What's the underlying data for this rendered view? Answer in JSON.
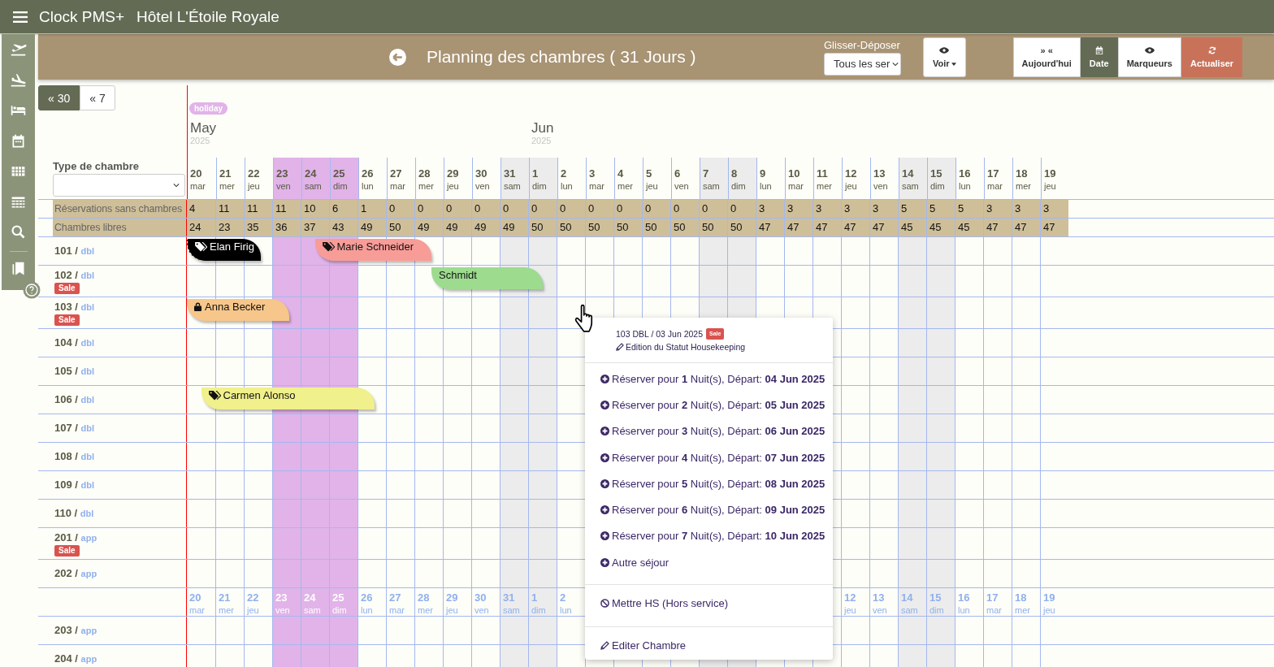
{
  "app": {
    "name": "Clock PMS+",
    "hotel": "Hôtel L'Étoile Royale"
  },
  "toolbar": {
    "title": "Planning des chambres ( 31 Jours )",
    "drag_label": "Glisser-Déposer",
    "filter_value": "Tous les ser",
    "buttons": [
      {
        "kind": "eye",
        "label": "Voir",
        "selected": false
      },
      {
        "kind": "glyph",
        "glyph": "» «",
        "label": "Aujourd'hui",
        "selected": false
      },
      {
        "kind": "calendar",
        "label": "Date",
        "selected": true
      },
      {
        "kind": "eye",
        "label": "Marqueurs",
        "selected": false
      },
      {
        "kind": "refresh",
        "label": "Actualiser",
        "selected": false
      }
    ]
  },
  "range_buttons": [
    {
      "label": "« 30",
      "selected": true
    },
    {
      "label": "« 7",
      "selected": false
    }
  ],
  "holiday_badge": "holiday",
  "months": [
    {
      "name": "May",
      "year": "2025"
    },
    {
      "name": "Jun",
      "year": "2025"
    }
  ],
  "room_type_label": "Type de chambre",
  "days": [
    {
      "num": "20",
      "dow": "mar",
      "kind": "weekday"
    },
    {
      "num": "21",
      "dow": "mer",
      "kind": "weekday"
    },
    {
      "num": "22",
      "dow": "jeu",
      "kind": "weekday"
    },
    {
      "num": "23",
      "dow": "ven",
      "kind": "holiday"
    },
    {
      "num": "24",
      "dow": "sam",
      "kind": "holiday"
    },
    {
      "num": "25",
      "dow": "dim",
      "kind": "holiday"
    },
    {
      "num": "26",
      "dow": "lun",
      "kind": "weekday"
    },
    {
      "num": "27",
      "dow": "mar",
      "kind": "weekday"
    },
    {
      "num": "28",
      "dow": "mer",
      "kind": "weekday"
    },
    {
      "num": "29",
      "dow": "jeu",
      "kind": "weekday"
    },
    {
      "num": "30",
      "dow": "ven",
      "kind": "weekday"
    },
    {
      "num": "31",
      "dow": "sam",
      "kind": "weekend"
    },
    {
      "num": "1",
      "dow": "dim",
      "kind": "weekend"
    },
    {
      "num": "2",
      "dow": "lun",
      "kind": "weekday"
    },
    {
      "num": "3",
      "dow": "mar",
      "kind": "weekday"
    },
    {
      "num": "4",
      "dow": "mer",
      "kind": "weekday"
    },
    {
      "num": "5",
      "dow": "jeu",
      "kind": "weekday"
    },
    {
      "num": "6",
      "dow": "ven",
      "kind": "weekday"
    },
    {
      "num": "7",
      "dow": "sam",
      "kind": "weekend"
    },
    {
      "num": "8",
      "dow": "dim",
      "kind": "weekend"
    },
    {
      "num": "9",
      "dow": "lun",
      "kind": "weekday"
    },
    {
      "num": "10",
      "dow": "mar",
      "kind": "weekday"
    },
    {
      "num": "11",
      "dow": "mer",
      "kind": "weekday"
    },
    {
      "num": "12",
      "dow": "jeu",
      "kind": "weekday"
    },
    {
      "num": "13",
      "dow": "ven",
      "kind": "weekday"
    },
    {
      "num": "14",
      "dow": "sam",
      "kind": "weekend"
    },
    {
      "num": "15",
      "dow": "dim",
      "kind": "weekend"
    },
    {
      "num": "16",
      "dow": "lun",
      "kind": "weekday"
    },
    {
      "num": "17",
      "dow": "mar",
      "kind": "weekday"
    },
    {
      "num": "18",
      "dow": "mer",
      "kind": "weekday"
    },
    {
      "num": "19",
      "dow": "jeu",
      "kind": "weekday"
    }
  ],
  "summary_rows": [
    {
      "label": "Réservations sans chambres",
      "values": [
        "4",
        "11",
        "11",
        "11",
        "10",
        "6",
        "1",
        "0",
        "0",
        "0",
        "0",
        "0",
        "0",
        "0",
        "0",
        "0",
        "0",
        "0",
        "0",
        "0",
        "3",
        "3",
        "3",
        "3",
        "3",
        "5",
        "5",
        "5",
        "3",
        "3",
        "3"
      ]
    },
    {
      "label": "Chambres libres",
      "values": [
        "24",
        "23",
        "35",
        "36",
        "37",
        "43",
        "49",
        "50",
        "49",
        "49",
        "49",
        "49",
        "50",
        "50",
        "50",
        "50",
        "50",
        "50",
        "50",
        "50",
        "47",
        "47",
        "47",
        "47",
        "47",
        "45",
        "45",
        "45",
        "47",
        "47",
        "47"
      ]
    }
  ],
  "rooms": [
    {
      "name": "101 /",
      "type": "dbl",
      "bookings": [
        {
          "guest": "Elan Firig",
          "color": "#000000",
          "kind": "tag"
        },
        {
          "guest": "Marie Schneider",
          "color": "#f89c98",
          "kind": "tag"
        }
      ]
    },
    {
      "name": "102 /",
      "type": "dbl",
      "badge": "Sale",
      "bookings": [
        {
          "guest": "Schmidt",
          "color": "#9ddb8f",
          "kind": "plain"
        }
      ]
    },
    {
      "name": "103 /",
      "type": "dbl",
      "badge": "Sale",
      "bookings": [
        {
          "guest": "Anna Becker",
          "color": "#f7c68a",
          "kind": "lock"
        }
      ]
    },
    {
      "name": "104 /",
      "type": "dbl"
    },
    {
      "name": "105 /",
      "type": "dbl"
    },
    {
      "name": "106 /",
      "type": "dbl",
      "bookings": [
        {
          "guest": "Carmen Alonso",
          "color": "#f0f08c",
          "kind": "tag"
        }
      ]
    },
    {
      "name": "107 /",
      "type": "dbl"
    },
    {
      "name": "108 /",
      "type": "dbl"
    },
    {
      "name": "109 /",
      "type": "dbl"
    },
    {
      "name": "110 /",
      "type": "dbl"
    },
    {
      "name": "201 /",
      "type": "app",
      "badge": "Sale"
    },
    {
      "name": "202 /",
      "type": "app"
    },
    {
      "kind": "date_header",
      "days": [
        {
          "num": "20",
          "dow": "mar",
          "kind": "weekday"
        },
        {
          "num": "21",
          "dow": "mer",
          "kind": "weekday"
        },
        {
          "num": "22",
          "dow": "jeu",
          "kind": "weekday"
        },
        {
          "num": "23",
          "dow": "ven",
          "kind": "holiday"
        },
        {
          "num": "24",
          "dow": "sam",
          "kind": "holiday"
        },
        {
          "num": "25",
          "dow": "dim",
          "kind": "holiday"
        },
        {
          "num": "26",
          "dow": "lun",
          "kind": "weekday"
        },
        {
          "num": "27",
          "dow": "mar",
          "kind": "weekday"
        },
        {
          "num": "28",
          "dow": "mer",
          "kind": "weekday"
        },
        {
          "num": "29",
          "dow": "jeu",
          "kind": "weekday"
        },
        {
          "num": "30",
          "dow": "ven",
          "kind": "weekday"
        },
        {
          "num": "31",
          "dow": "sam",
          "kind": "weekend"
        },
        {
          "num": "1",
          "dow": "dim",
          "kind": "weekend"
        },
        {
          "num": "2",
          "dow": "lun",
          "kind": "weekday"
        },
        {
          "num": "12",
          "dow": "jeu",
          "kind": "weekday"
        },
        {
          "num": "13",
          "dow": "ven",
          "kind": "weekday"
        },
        {
          "num": "14",
          "dow": "sam",
          "kind": "weekend"
        },
        {
          "num": "15",
          "dow": "dim",
          "kind": "weekend"
        },
        {
          "num": "16",
          "dow": "lun",
          "kind": "weekday"
        },
        {
          "num": "17",
          "dow": "mar",
          "kind": "weekday"
        },
        {
          "num": "18",
          "dow": "mer",
          "kind": "weekday"
        },
        {
          "num": "19",
          "dow": "jeu",
          "kind": "weekday"
        }
      ]
    },
    {
      "name": "203 /",
      "type": "app"
    },
    {
      "name": "204 /",
      "type": "app"
    }
  ],
  "context_menu": {
    "room_date": "103 DBL / 03 Jun 2025",
    "badge": "Sale",
    "housekeeping": "Edition du Statut Housekeeping",
    "items": [
      {
        "kind": "add",
        "text": "Réserver pour **1** Nuit(s), Départ: **04 Jun 2025**"
      },
      {
        "kind": "add",
        "text": "Réserver pour **2** Nuit(s), Départ: **05 Jun 2025**"
      },
      {
        "kind": "add",
        "text": "Réserver pour **3** Nuit(s), Départ: **06 Jun 2025**"
      },
      {
        "kind": "add",
        "text": "Réserver pour **4** Nuit(s), Départ: **07 Jun 2025**"
      },
      {
        "kind": "add",
        "text": "Réserver pour **5** Nuit(s), Départ: **08 Jun 2025**"
      },
      {
        "kind": "add",
        "text": "Réserver pour **6** Nuit(s), Départ: **09 Jun 2025**"
      },
      {
        "kind": "add",
        "text": "Réserver pour **7** Nuit(s), Départ: **10 Jun 2025**"
      },
      {
        "kind": "add",
        "text": "Autre séjour"
      },
      {
        "kind": "block",
        "text": "Mettre HS (Hors service)"
      },
      {
        "kind": "edit",
        "text": "Editer Chambre"
      }
    ]
  }
}
